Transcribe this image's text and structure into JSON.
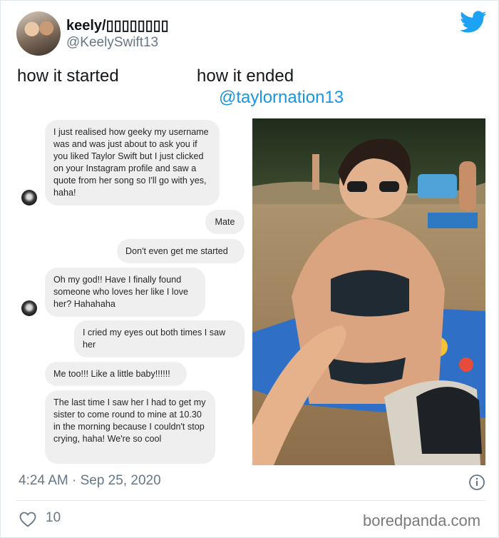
{
  "tweet": {
    "display_name": "keely/▯▯▯▯▯▯▯▯",
    "handle": "@KeelySwift13",
    "caption_left": "how it started",
    "caption_right": "how it ended",
    "mention": "@taylornation13",
    "timestamp": "4:24 AM · Sep 25, 2020",
    "like_count": "10",
    "brand_color": "#1da1f2",
    "link_color": "#1b95e0"
  },
  "chat": [
    {
      "side": "left",
      "text": "I just realised how geeky my username was and was just about to ask you if you liked Taylor Swift but I just clicked on your Instagram profile and saw a quote from her song so I'll go with yes, haha!"
    },
    {
      "side": "right",
      "text": "Mate"
    },
    {
      "side": "right",
      "text": "Don't even get me started"
    },
    {
      "side": "left",
      "text": "Oh my god!! Have I finally found someone who loves her like I love her? Hahahaha"
    },
    {
      "side": "right",
      "text": "I cried my eyes out both times I saw her"
    },
    {
      "side": "left",
      "text": "Me too!!! Like a little baby!!!!!!"
    },
    {
      "side": "left",
      "text": "The last time I saw her I had to get my sister to come round to mine at 10.30 in the morning because I couldn't stop crying, haha! We're so cool"
    }
  ],
  "watermark": "boredpanda.com",
  "icons": {
    "brand": "twitter-bird-icon",
    "info": "info-icon",
    "like": "heart-icon"
  }
}
